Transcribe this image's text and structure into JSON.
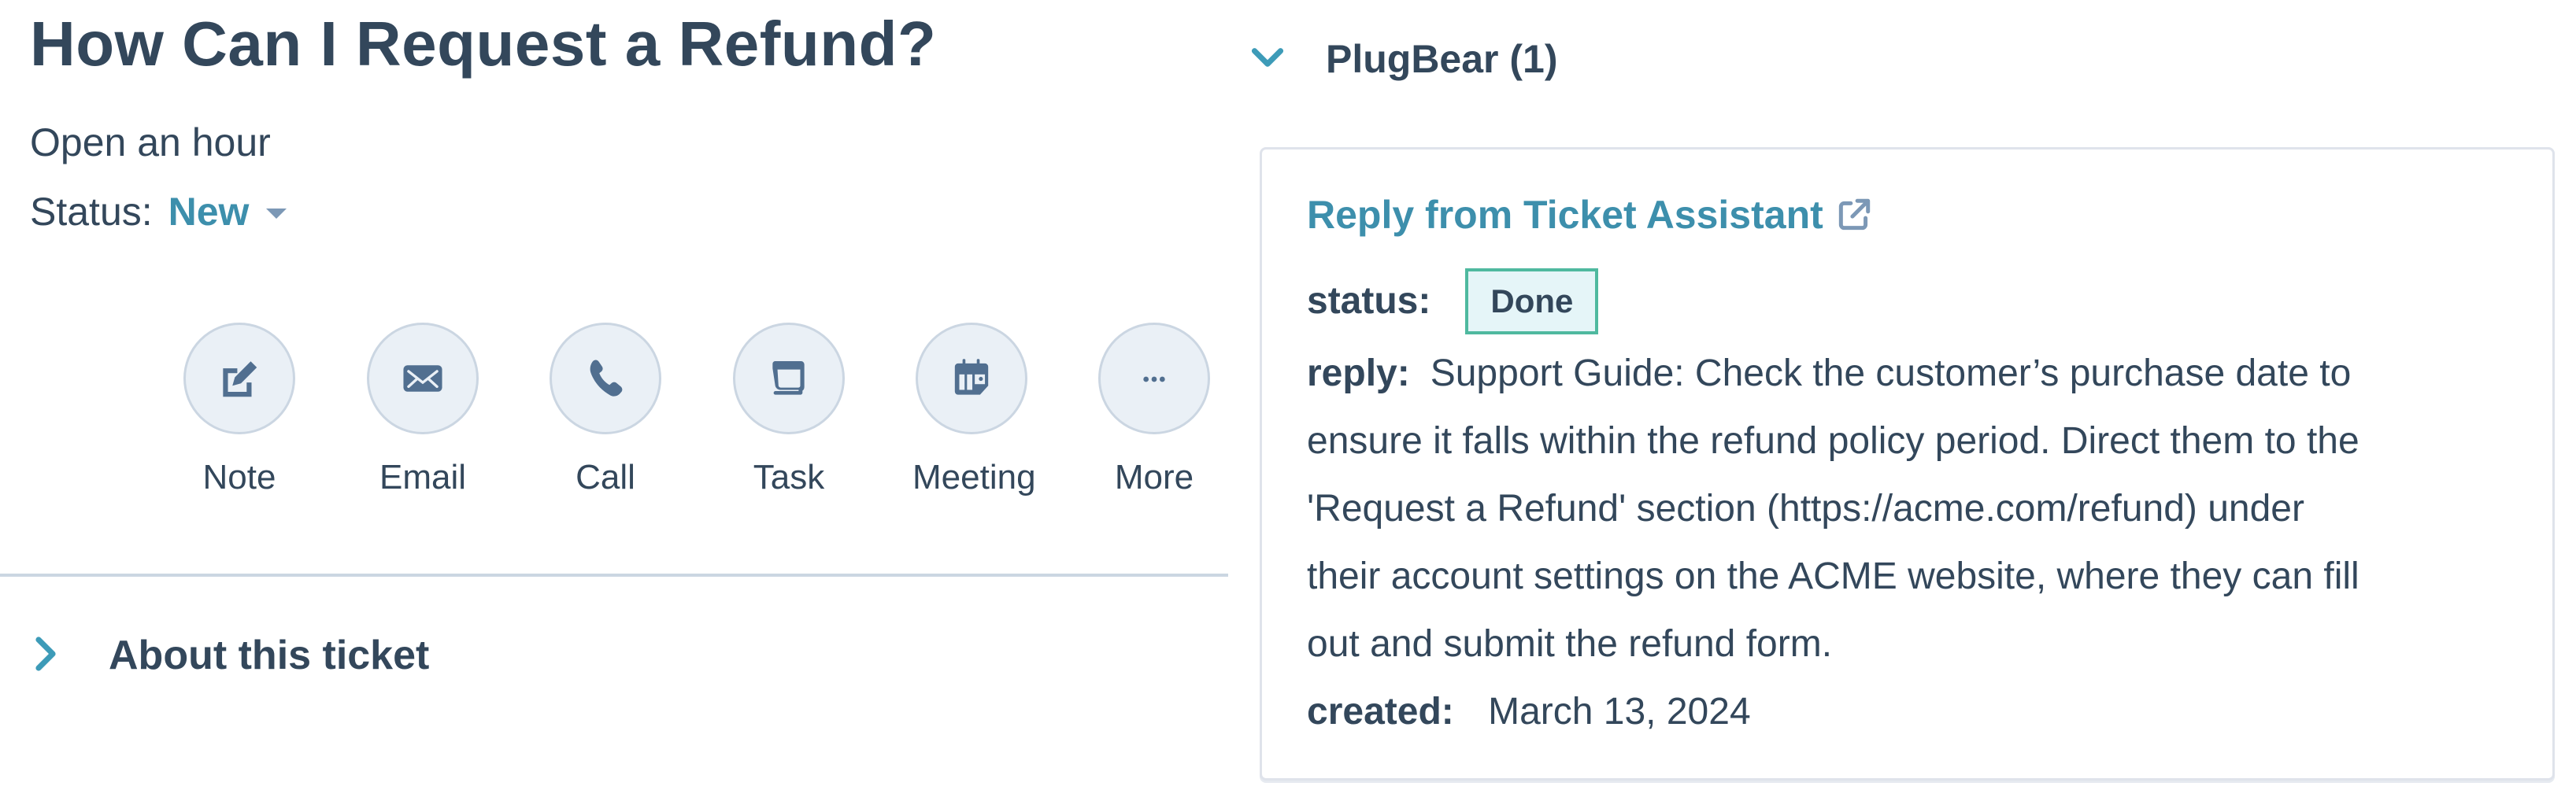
{
  "ticket": {
    "title": "How Can I Request a Refund?",
    "open_time": "Open an hour",
    "status_label": "Status:",
    "status_value": "New"
  },
  "actions": [
    {
      "label": "Note",
      "icon": "note-edit-icon"
    },
    {
      "label": "Email",
      "icon": "email-icon"
    },
    {
      "label": "Call",
      "icon": "phone-icon"
    },
    {
      "label": "Task",
      "icon": "task-icon"
    },
    {
      "label": "Meeting",
      "icon": "calendar-icon"
    },
    {
      "label": "More",
      "icon": "more-dots-icon"
    }
  ],
  "about_section": {
    "label": "About this ticket",
    "expanded": false
  },
  "plugbear": {
    "header": "PlugBear (1)",
    "expanded": true,
    "card": {
      "link_text": "Reply from Ticket Assistant",
      "status_key": "status:",
      "status_value": "Done",
      "reply_key": "reply:",
      "reply_lines": [
        "Support Guide: Check the customer’s purchase date to",
        "ensure it falls within the refund policy period. Direct them to the",
        "'Request a Refund' section (https://acme.com/refund) under",
        "their account settings on the ACME website, where they can fill",
        "out and submit the refund form."
      ],
      "created_key": "created:",
      "created_value": "March 13, 2024"
    }
  },
  "colors": {
    "text": "#33475b",
    "accent": "#3d8fac",
    "icon": "#516f90",
    "circle_bg": "#eaf0f6",
    "circle_border": "#cbd6e2",
    "badge_bg": "#e5f5f8",
    "badge_border": "#4fb99f"
  }
}
